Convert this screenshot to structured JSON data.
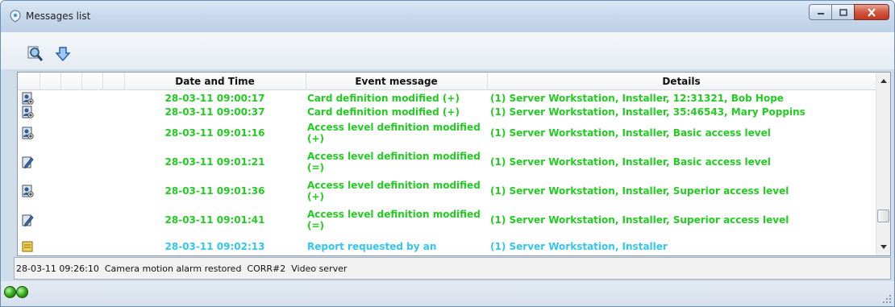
{
  "window": {
    "title": "Messages list"
  },
  "toolbar": {
    "search_icon": "search-icon",
    "download_icon": "download-arrow-icon"
  },
  "grid": {
    "columns": [
      "",
      "Date and Time",
      "Event message",
      "Details"
    ],
    "rows": [
      {
        "icon": "person-plus-icon",
        "date": "28-03-11 09:00:17",
        "event": "Card definition modified (+)",
        "details": "(1)  Server Workstation, Installer, 12:31321, Bob Hope",
        "color": "#22cc22"
      },
      {
        "icon": "person-plus-icon",
        "date": "28-03-11 09:00:37",
        "event": "Card definition modified (+)",
        "details": "(1)  Server Workstation, Installer, 35:46543, Mary Poppins",
        "color": "#22cc22"
      },
      {
        "icon": "person-plus-icon",
        "date": "28-03-11 09:01:16",
        "event": "Access level definition modified (+)",
        "details": "(1)  Server Workstation, Installer, Basic access level",
        "color": "#22cc22"
      },
      {
        "icon": "edit-pencil-icon",
        "date": "28-03-11 09:01:21",
        "event": "Access level definition modified (=)",
        "details": "(1)  Server Workstation, Installer, Basic access level",
        "color": "#22cc22"
      },
      {
        "icon": "person-plus-icon",
        "date": "28-03-11 09:01:36",
        "event": "Access level definition modified (+)",
        "details": "(1)  Server Workstation, Installer, Superior access level",
        "color": "#22cc22"
      },
      {
        "icon": "edit-pencil-icon",
        "date": "28-03-11 09:01:41",
        "event": "Access level definition modified (=)",
        "details": "(1)  Server Workstation, Installer, Superior access level",
        "color": "#22cc22"
      },
      {
        "icon": "report-icon",
        "date": "28-03-11 09:02:13",
        "event": "Report requested by an",
        "details": "(1)  Server Workstation, Installer",
        "color": "#33c6ee"
      }
    ]
  },
  "status": {
    "text": "28-03-11 09:26:10  Camera motion alarm restored  CORR#2  Video server"
  },
  "bottom": {
    "indicators": [
      "green-led-icon",
      "green-led-icon"
    ]
  },
  "colors": {
    "event_green": "#22cc22",
    "event_cyan": "#33c6ee"
  }
}
